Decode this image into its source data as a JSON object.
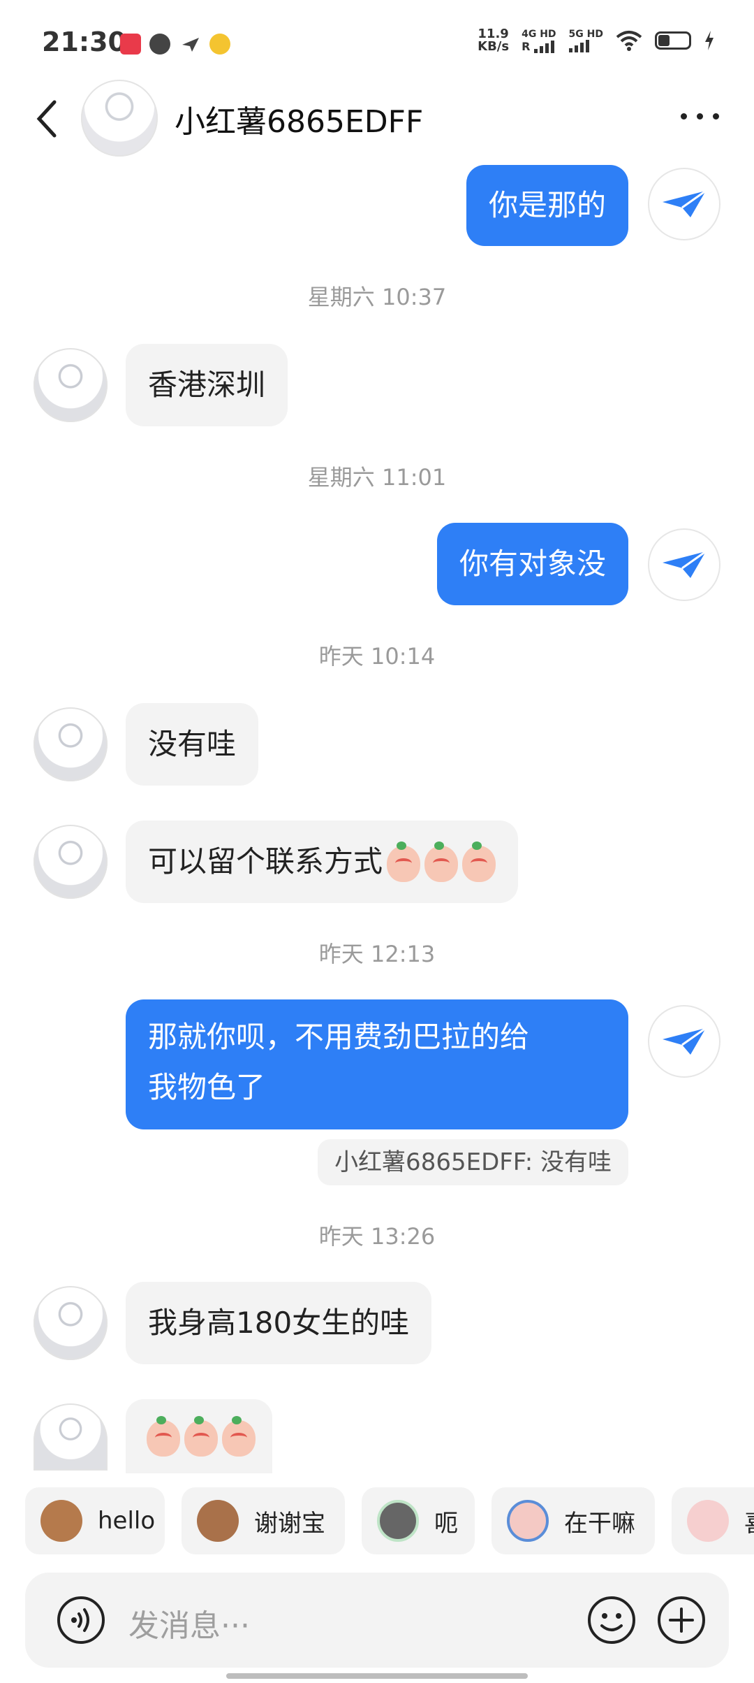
{
  "status": {
    "time": "21:30",
    "speed_value": "11.9",
    "speed_unit": "KB/s",
    "net1": "4G HD",
    "net1_sub": "R",
    "net2": "5G HD"
  },
  "header": {
    "title": "小红薯6865EDFF"
  },
  "messages": {
    "m1": "你是那的",
    "ts1": "星期六 10:37",
    "m2": "香港深圳",
    "ts2": "星期六 11:01",
    "m3": "你有对象没",
    "ts3": "昨天 10:14",
    "m4": "没有哇",
    "m5": "可以留个联系方式",
    "ts4": "昨天 12:13",
    "m6_line1": "那就你呗，不用费劲巴拉的给",
    "m6_line2": "我物色了",
    "quote": "小红薯6865EDFF: 没有哇",
    "ts5": "昨天 13:26",
    "m7": "我身高180女生的哇"
  },
  "chips": {
    "c1": "hello",
    "c2": "谢谢宝",
    "c3": "呃",
    "c4": "在干嘛",
    "c5": "喜"
  },
  "input": {
    "placeholder": "发消息···"
  }
}
